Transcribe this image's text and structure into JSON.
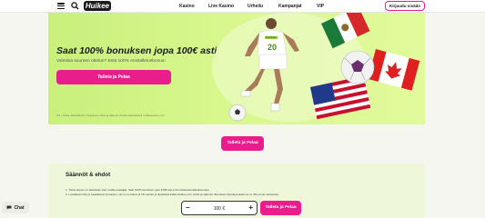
{
  "header": {
    "logo_text": "Huikee",
    "nav": [
      "Kasino",
      "Live Kasino",
      "Urheilu",
      "Kampanjat",
      "VIP"
    ],
    "login_label": "Kirjaudu sisään"
  },
  "hero": {
    "title": "Saat 100% bonuksen jopa 100€ asti",
    "subtitle": "Valmiina suureen ottelun? Entä 100% ensitalletusbonus!",
    "cta_label": "Talleta ja Pelaa",
    "terms": "18+ | Pelaa vastuullisesti | Tarjouksen ehdot ja säännöt | Pelaa vastuullisesti | huikeecasino.com",
    "player_number": "20",
    "jersey_brand": "Huikee"
  },
  "middle": {
    "cta_label": "Talleta ja Pelaa"
  },
  "rules": {
    "title": "Säännöt & ehdot",
    "lines": [
      "1. Tämä tarjous on tarkoitettu vain uusille pelaajille. Saat 100% bonuksen jopa 100€ asti ensimmäisestä talletuksestasi.",
      "2. Luodaksesi tilin ja saadaksesi bonuksen, sinun on oltava yli 18-vuotias ja täytettävä kaikki Huikee.com ehdot ja säännöt. Bonuksen kierrätysvaatimus on 35x ennen kotiutusta."
    ]
  },
  "bottom_bar": {
    "chat_label": "Chat",
    "amount": "100 €",
    "minus": "−",
    "plus": "+",
    "cta_label": "Talleta ja Pelaa"
  },
  "colors": {
    "accent": "#e91e8c",
    "hero_bg": "#d8f78d",
    "rules_bg": "#eef7da"
  }
}
